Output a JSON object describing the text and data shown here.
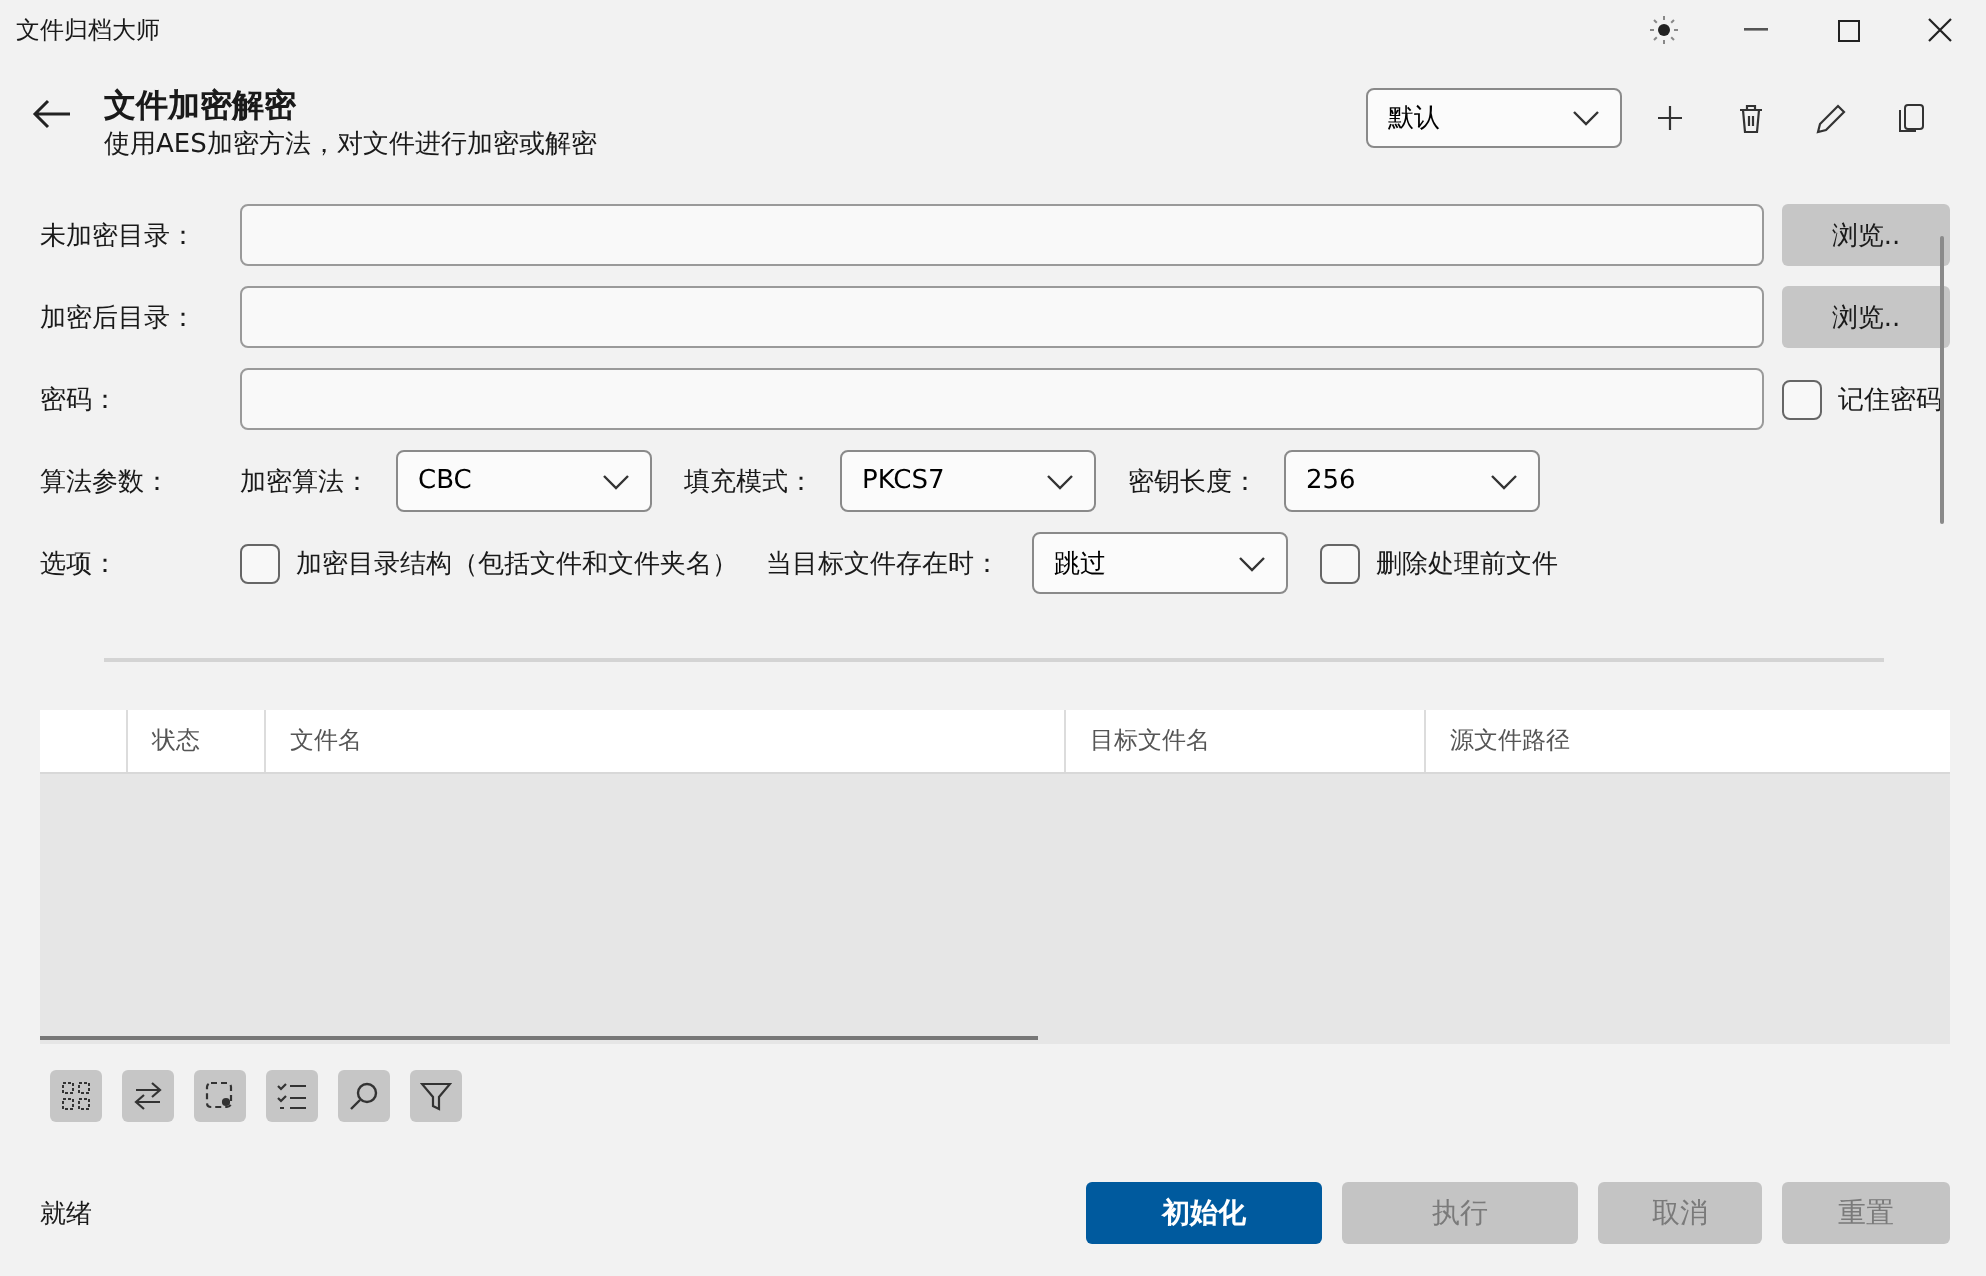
{
  "window": {
    "title": "文件归档大师"
  },
  "header": {
    "title": "文件加密解密",
    "subtitle": "使用AES加密方法，对文件进行加密或解密",
    "profile": "默认"
  },
  "fields": [
    {
      "label": "未加密目录：",
      "kind": "browse",
      "action": "浏览.."
    },
    {
      "label": "加密后目录：",
      "kind": "browse",
      "action": "浏览.."
    },
    {
      "label": "密码：",
      "kind": "password",
      "checkbox": {
        "label": "记住密码",
        "checked": false
      }
    }
  ],
  "algorithm": {
    "label": "算法参数：",
    "combos": [
      {
        "label": "加密算法：",
        "value": "CBC"
      },
      {
        "label": "填充模式：",
        "value": "PKCS7"
      },
      {
        "label": "密钥长度：",
        "value": "256"
      }
    ]
  },
  "options": {
    "label": "选项：",
    "items": [
      {
        "kind": "checkbox",
        "label": "加密目录结构（包括文件和文件夹名）",
        "checked": false
      },
      {
        "kind": "combo",
        "label": "当目标文件存在时：",
        "value": "跳过"
      },
      {
        "kind": "checkbox",
        "label": "删除处理前文件",
        "checked": false
      }
    ]
  },
  "table": {
    "columns": [
      "状态",
      "文件名",
      "目标文件名",
      "源文件路径"
    ]
  },
  "status": "就绪",
  "buttons": [
    {
      "label": "初始化",
      "kind": "primary",
      "disabled": false
    },
    {
      "label": "执行",
      "kind": "normal",
      "disabled": true
    },
    {
      "label": "取消",
      "kind": "normal",
      "disabled": true
    },
    {
      "label": "重置",
      "kind": "normal",
      "disabled": true
    }
  ]
}
